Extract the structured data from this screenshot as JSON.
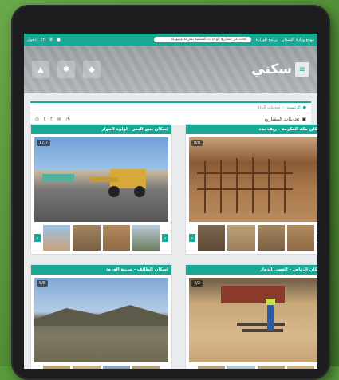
{
  "topbar": {
    "ministry_link": "موقع وزارة الإسكان",
    "ministers_program": "برامج الوزارة",
    "search_placeholder": "ابحث عن مشاريع الوحدات السكنية بسرعة وسهولة",
    "lang": "En",
    "login": "دخول"
  },
  "header": {
    "brand": "سكني"
  },
  "breadcrumb": {
    "home": "الرئيسية",
    "current": "تحديثات البناء"
  },
  "page": {
    "title": "تحديثات المشاريع"
  },
  "projects": [
    {
      "title": "إسكان ينبع البحر - لؤلؤة الحوار",
      "counter": "17/7",
      "scene": "s1"
    },
    {
      "title": "إسكان مكة المكرمة - ريف بدة",
      "counter": "8/8",
      "scene": "s2"
    },
    {
      "title": "إسكان الطائف - مدينة الورود",
      "counter": "9/8",
      "scene": "s3"
    },
    {
      "title": "إسكان الرياض - الغصن الدوار",
      "counter": "4/2",
      "scene": "s4"
    }
  ],
  "icons": {
    "print": "print-icon",
    "twitter": "twitter-icon",
    "facebook": "facebook-icon",
    "email": "mail-icon",
    "whatsapp": "whatsapp-icon"
  },
  "colors": {
    "accent": "#1aa794",
    "tablet": "#1d1d1f",
    "background": "#5a9a3e"
  }
}
